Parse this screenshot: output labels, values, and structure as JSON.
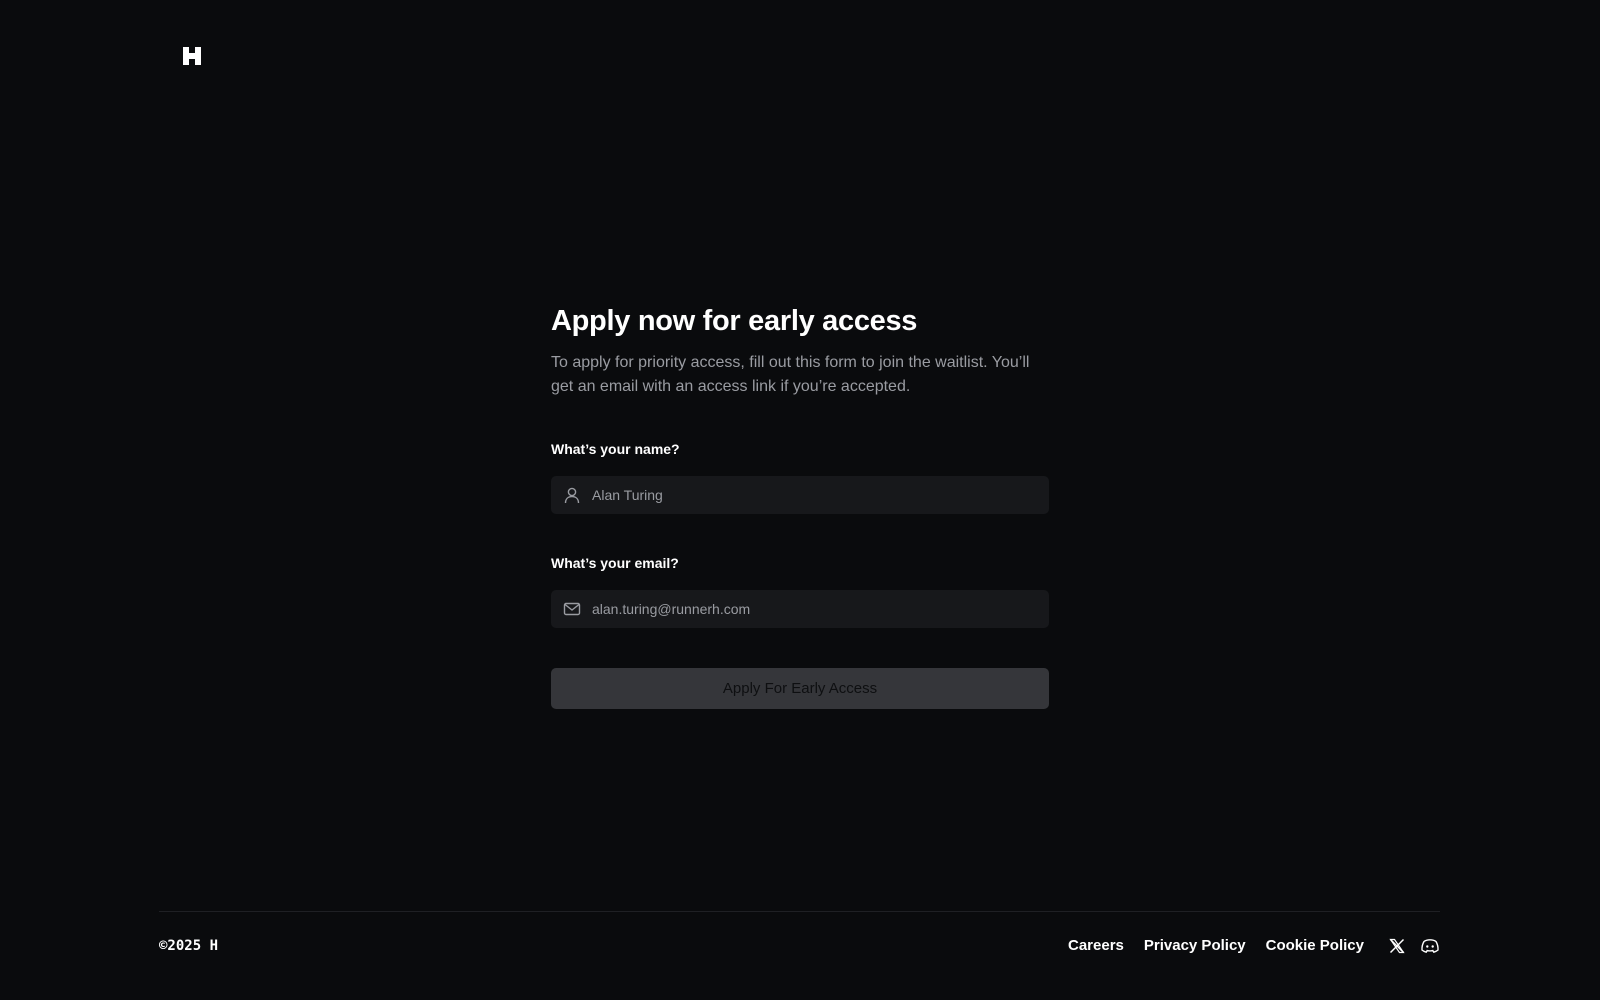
{
  "brand": {
    "logo_icon": "h-logo-icon"
  },
  "form": {
    "title": "Apply now for early access",
    "subtitle": "To apply for priority access, fill out this form to join the waitlist. You’ll get an email with an access link if you’re accepted.",
    "name_label": "What’s your name?",
    "name_placeholder": "Alan Turing",
    "name_value": "",
    "name_icon": "user-icon",
    "email_label": "What’s your email?",
    "email_placeholder": "alan.turing@runnerh.com",
    "email_value": "",
    "email_icon": "mail-icon",
    "submit_label": "Apply For Early Access",
    "submit_enabled": false
  },
  "footer": {
    "copyright": "©2025 H",
    "links": [
      "Careers",
      "Privacy Policy",
      "Cookie Policy"
    ],
    "social_icons": [
      "x-icon",
      "discord-icon"
    ]
  },
  "colors": {
    "background": "#0a0b0d",
    "input_background": "#17181b",
    "button_disabled": "#35363a",
    "muted_text": "#9a9ca2"
  }
}
